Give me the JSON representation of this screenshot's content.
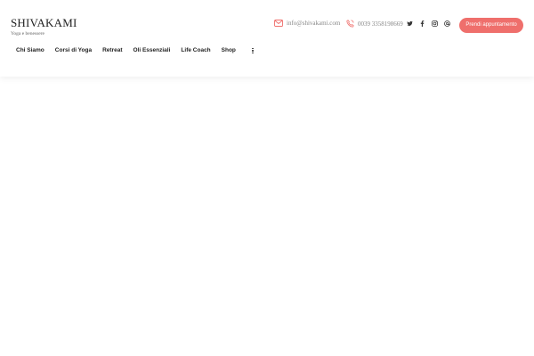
{
  "brand": {
    "name": "SHIVAKAMI",
    "tagline": "Yoga e benessere"
  },
  "contact": {
    "email": "info@shivakami.com",
    "phone": "0039 3358198669"
  },
  "social": [
    {
      "icon": "twitter-icon"
    },
    {
      "icon": "facebook-icon"
    },
    {
      "icon": "instagram-icon"
    },
    {
      "icon": "threads-icon"
    }
  ],
  "cta": {
    "label": "Prendi appuntamento"
  },
  "nav": {
    "items": [
      {
        "label": "Chi Siamo"
      },
      {
        "label": "Corsi di Yoga"
      },
      {
        "label": "Retreat"
      },
      {
        "label": "Oli Essenziali"
      },
      {
        "label": "Life Coach"
      },
      {
        "label": "Shop"
      }
    ],
    "more_icon": "more-vertical-icon"
  },
  "colors": {
    "accent": "#ef6f6c",
    "text": "#222222",
    "muted": "#888888",
    "background": "#ffffff"
  }
}
